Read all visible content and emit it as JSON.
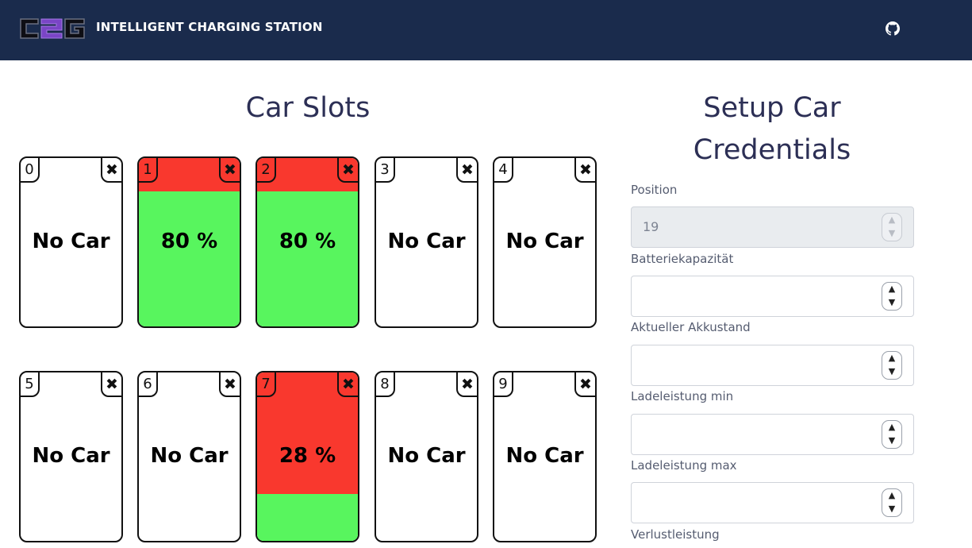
{
  "header": {
    "app_title": "INTELLIGENT CHARGING STATION",
    "logo_text": "C2G",
    "github_icon": "github-icon",
    "colors": {
      "navbar": "#1a2b4c",
      "logo_purple": "#7a45c6"
    }
  },
  "car_slots": {
    "title": "Car Slots",
    "close_symbol": "✖",
    "colors": {
      "charged": "#58f55e",
      "uncharged": "#f9382e",
      "empty": "#ffffff"
    },
    "slots": [
      {
        "id": "0",
        "label": "No Car",
        "occupied": false
      },
      {
        "id": "1",
        "label": "80 %",
        "occupied": true,
        "charge_percent": 80
      },
      {
        "id": "2",
        "label": "80 %",
        "occupied": true,
        "charge_percent": 80
      },
      {
        "id": "3",
        "label": "No Car",
        "occupied": false
      },
      {
        "id": "4",
        "label": "No Car",
        "occupied": false
      },
      {
        "id": "5",
        "label": "No Car",
        "occupied": false
      },
      {
        "id": "6",
        "label": "No Car",
        "occupied": false
      },
      {
        "id": "7",
        "label": "28 %",
        "occupied": true,
        "charge_percent": 28
      },
      {
        "id": "8",
        "label": "No Car",
        "occupied": false
      },
      {
        "id": "9",
        "label": "No Car",
        "occupied": false
      }
    ]
  },
  "setup": {
    "title_line1": "Setup Car",
    "title_line2": "Credentials",
    "fields": [
      {
        "label": "Position",
        "value": "19",
        "disabled": true
      },
      {
        "label": "Batteriekapazität",
        "value": "",
        "disabled": false
      },
      {
        "label": "Aktueller Akkustand",
        "value": "",
        "disabled": false
      },
      {
        "label": "Ladeleistung min",
        "value": "",
        "disabled": false
      },
      {
        "label": "Ladeleistung max",
        "value": "",
        "disabled": false
      },
      {
        "label": "Verlustleistung"
      }
    ],
    "spinner_up": "▲",
    "spinner_down": "▼"
  }
}
